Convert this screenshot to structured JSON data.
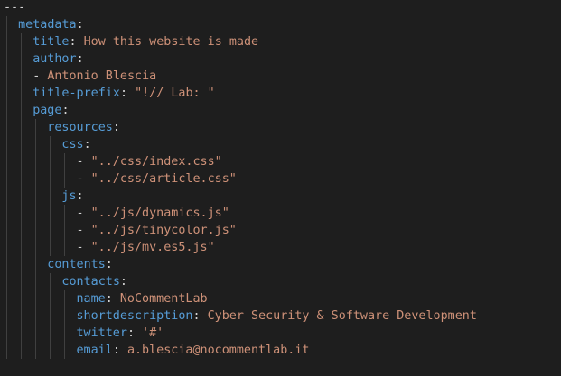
{
  "editor": {
    "colors": {
      "background": "#1e1e1e",
      "key": "#569cd6",
      "punctuation": "#d4d4d4",
      "string": "#ce9178",
      "indent_guide": "#404040"
    },
    "lines": [
      {
        "indent": 0,
        "punct": "---"
      },
      {
        "indent": 1,
        "key": "metadata",
        "colon": ":"
      },
      {
        "indent": 2,
        "key": "title",
        "colon": ": ",
        "value": "How this website is made"
      },
      {
        "indent": 2,
        "key": "author",
        "colon": ":"
      },
      {
        "indent": 2,
        "dash": "- ",
        "value": "Antonio Blescia"
      },
      {
        "indent": 2,
        "key": "title-prefix",
        "colon": ": ",
        "value": "\"!// Lab: \""
      },
      {
        "indent": 2,
        "key": "page",
        "colon": ":"
      },
      {
        "indent": 3,
        "key": "resources",
        "colon": ":"
      },
      {
        "indent": 4,
        "key": "css",
        "colon": ":"
      },
      {
        "indent": 5,
        "dash": "- ",
        "value": "\"../css/index.css\""
      },
      {
        "indent": 5,
        "dash": "- ",
        "value": "\"../css/article.css\""
      },
      {
        "indent": 4,
        "key": "js",
        "colon": ":"
      },
      {
        "indent": 5,
        "dash": "- ",
        "value": "\"../js/dynamics.js\""
      },
      {
        "indent": 5,
        "dash": "- ",
        "value": "\"../js/tinycolor.js\""
      },
      {
        "indent": 5,
        "dash": "- ",
        "value": "\"../js/mv.es5.js\""
      },
      {
        "indent": 3,
        "key": "contents",
        "colon": ":"
      },
      {
        "indent": 4,
        "key": "contacts",
        "colon": ":"
      },
      {
        "indent": 5,
        "key": "name",
        "colon": ": ",
        "value": "NoCommentLab"
      },
      {
        "indent": 5,
        "key": "shortdescription",
        "colon": ": ",
        "value": "Cyber Security & Software Development"
      },
      {
        "indent": 5,
        "key": "twitter",
        "colon": ": ",
        "value": "'#'"
      },
      {
        "indent": 5,
        "key": "email",
        "colon": ": ",
        "value": "a.blescia@nocommentlab.it"
      }
    ]
  }
}
